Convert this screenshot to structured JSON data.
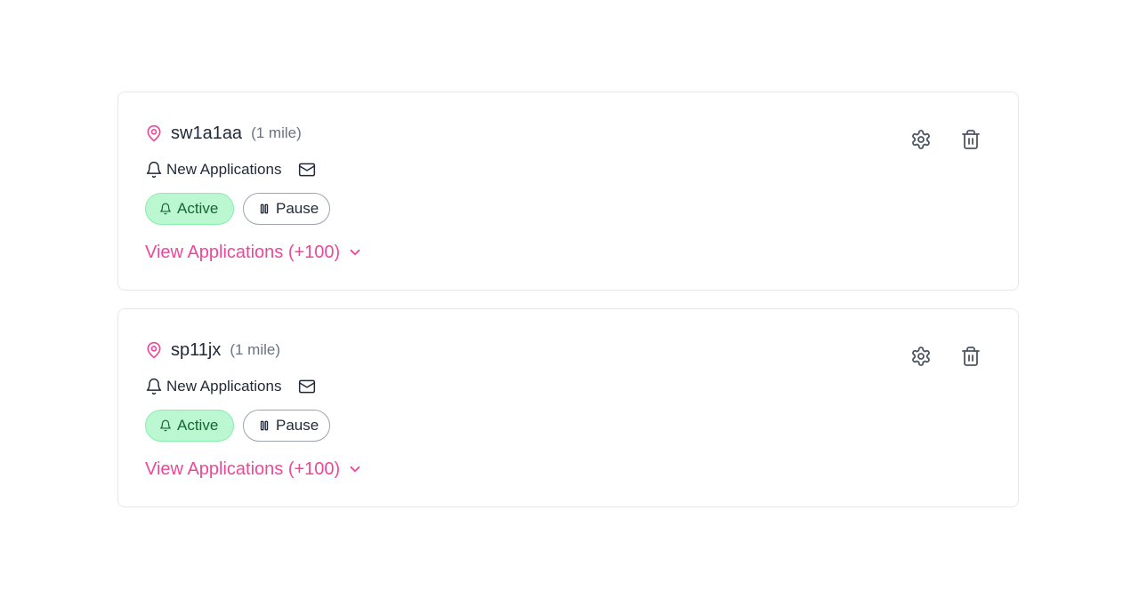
{
  "colors": {
    "accent": "#ec4899",
    "active_bg": "#bbf7d0",
    "active_text": "#166534",
    "muted": "#6b7280",
    "border": "#e5e7eb"
  },
  "alerts": [
    {
      "postcode": "sw1a1aa",
      "distance": "(1 mile)",
      "notify_label": "New Applications",
      "active_label": "Active",
      "pause_label": "Pause",
      "view_label": "View Applications (+100)",
      "icons": [
        "map-pin-icon",
        "bell-icon",
        "mail-icon",
        "gear-icon",
        "trash-icon",
        "chevron-down-icon"
      ]
    },
    {
      "postcode": "sp11jx",
      "distance": "(1 mile)",
      "notify_label": "New Applications",
      "active_label": "Active",
      "pause_label": "Pause",
      "view_label": "View Applications (+100)",
      "icons": [
        "map-pin-icon",
        "bell-icon",
        "mail-icon",
        "gear-icon",
        "trash-icon",
        "chevron-down-icon"
      ]
    }
  ]
}
